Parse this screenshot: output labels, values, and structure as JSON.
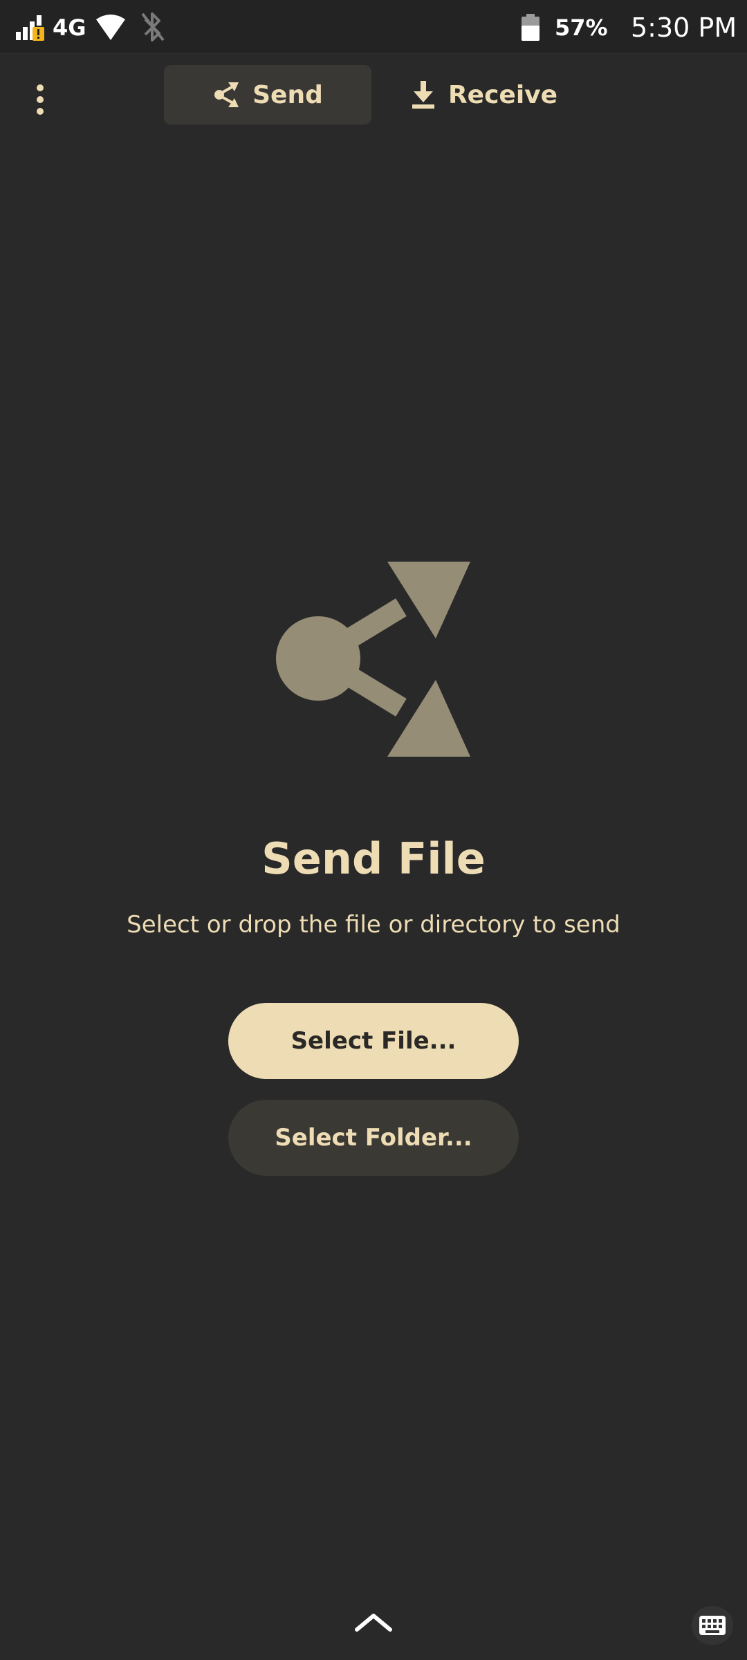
{
  "status_bar": {
    "network": "4G",
    "battery": "57%",
    "time": "5:30 PM",
    "icons": [
      "signal-icon",
      "wifi-icon",
      "bluetooth-icon",
      "battery-icon"
    ]
  },
  "header": {
    "menu_icon": "more-vertical-icon",
    "tabs": [
      {
        "label": "Send",
        "icon": "share-icon",
        "active": true
      },
      {
        "label": "Receive",
        "icon": "download-icon",
        "active": false
      }
    ]
  },
  "main": {
    "hero_icon": "share-icon",
    "title": "Send File",
    "subtitle": "Select or drop the file or directory to send",
    "select_file_label": "Select File...",
    "select_folder_label": "Select Folder..."
  },
  "nav": {
    "handle_icon": "chevron-up-icon",
    "keyboard_icon": "keyboard-icon"
  },
  "colors": {
    "background": "#292929",
    "accent": "#eddcb4",
    "icon_muted": "#958d76",
    "button_secondary": "#3b3934",
    "warning": "#f2b51c"
  }
}
